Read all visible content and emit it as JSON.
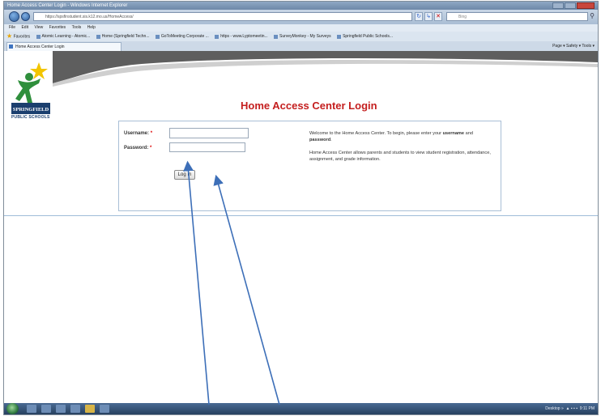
{
  "window": {
    "title": "Home Access Center Login - Windows Internet Explorer",
    "address": "https://spsfinstudent.sis.k12.mo.us/HomeAccess/",
    "address_highlight": "k12.mo.us",
    "search_placeholder": "Bing"
  },
  "menu": [
    "File",
    "Edit",
    "View",
    "Favorites",
    "Tools",
    "Help"
  ],
  "favorites": {
    "label": "Favorites",
    "items": [
      "Atomic Learning - Atomic...",
      "Home (Springfield Techn...",
      "GoToMeeting Corporate ...",
      "https - www.Lyptomeetin...",
      "SurveyMonkey - My Surveys",
      "Springfield Public Schools..."
    ]
  },
  "tab": {
    "label": "Home Access Center Login"
  },
  "command_bar": "Page ▾  Safety ▾  Tools ▾",
  "logo": {
    "text": "SPRINGFIELD",
    "subtext": "PUBLIC SCHOOLS"
  },
  "page": {
    "title": "Home Access Center Login",
    "username_label": "Username:",
    "password_label": "Password:",
    "required_mark": "*",
    "login_button": "Log In",
    "welcome_text_1": "Welcome to the Home Access Center. To begin, please enter your",
    "welcome_bold_1": "username",
    "welcome_and": "and",
    "welcome_bold_2": "password",
    "welcome_end": ".",
    "about_text": "Home Access Center allows parents and students to view student registration, attendance, assignment, and grade information."
  },
  "taskbar": {
    "tray_text": "Desktop »",
    "clock": "9:11 PM"
  },
  "colors": {
    "title_red": "#c41e1e",
    "arrow_blue": "#3d6fb8",
    "box_border": "#a9bfd6"
  }
}
